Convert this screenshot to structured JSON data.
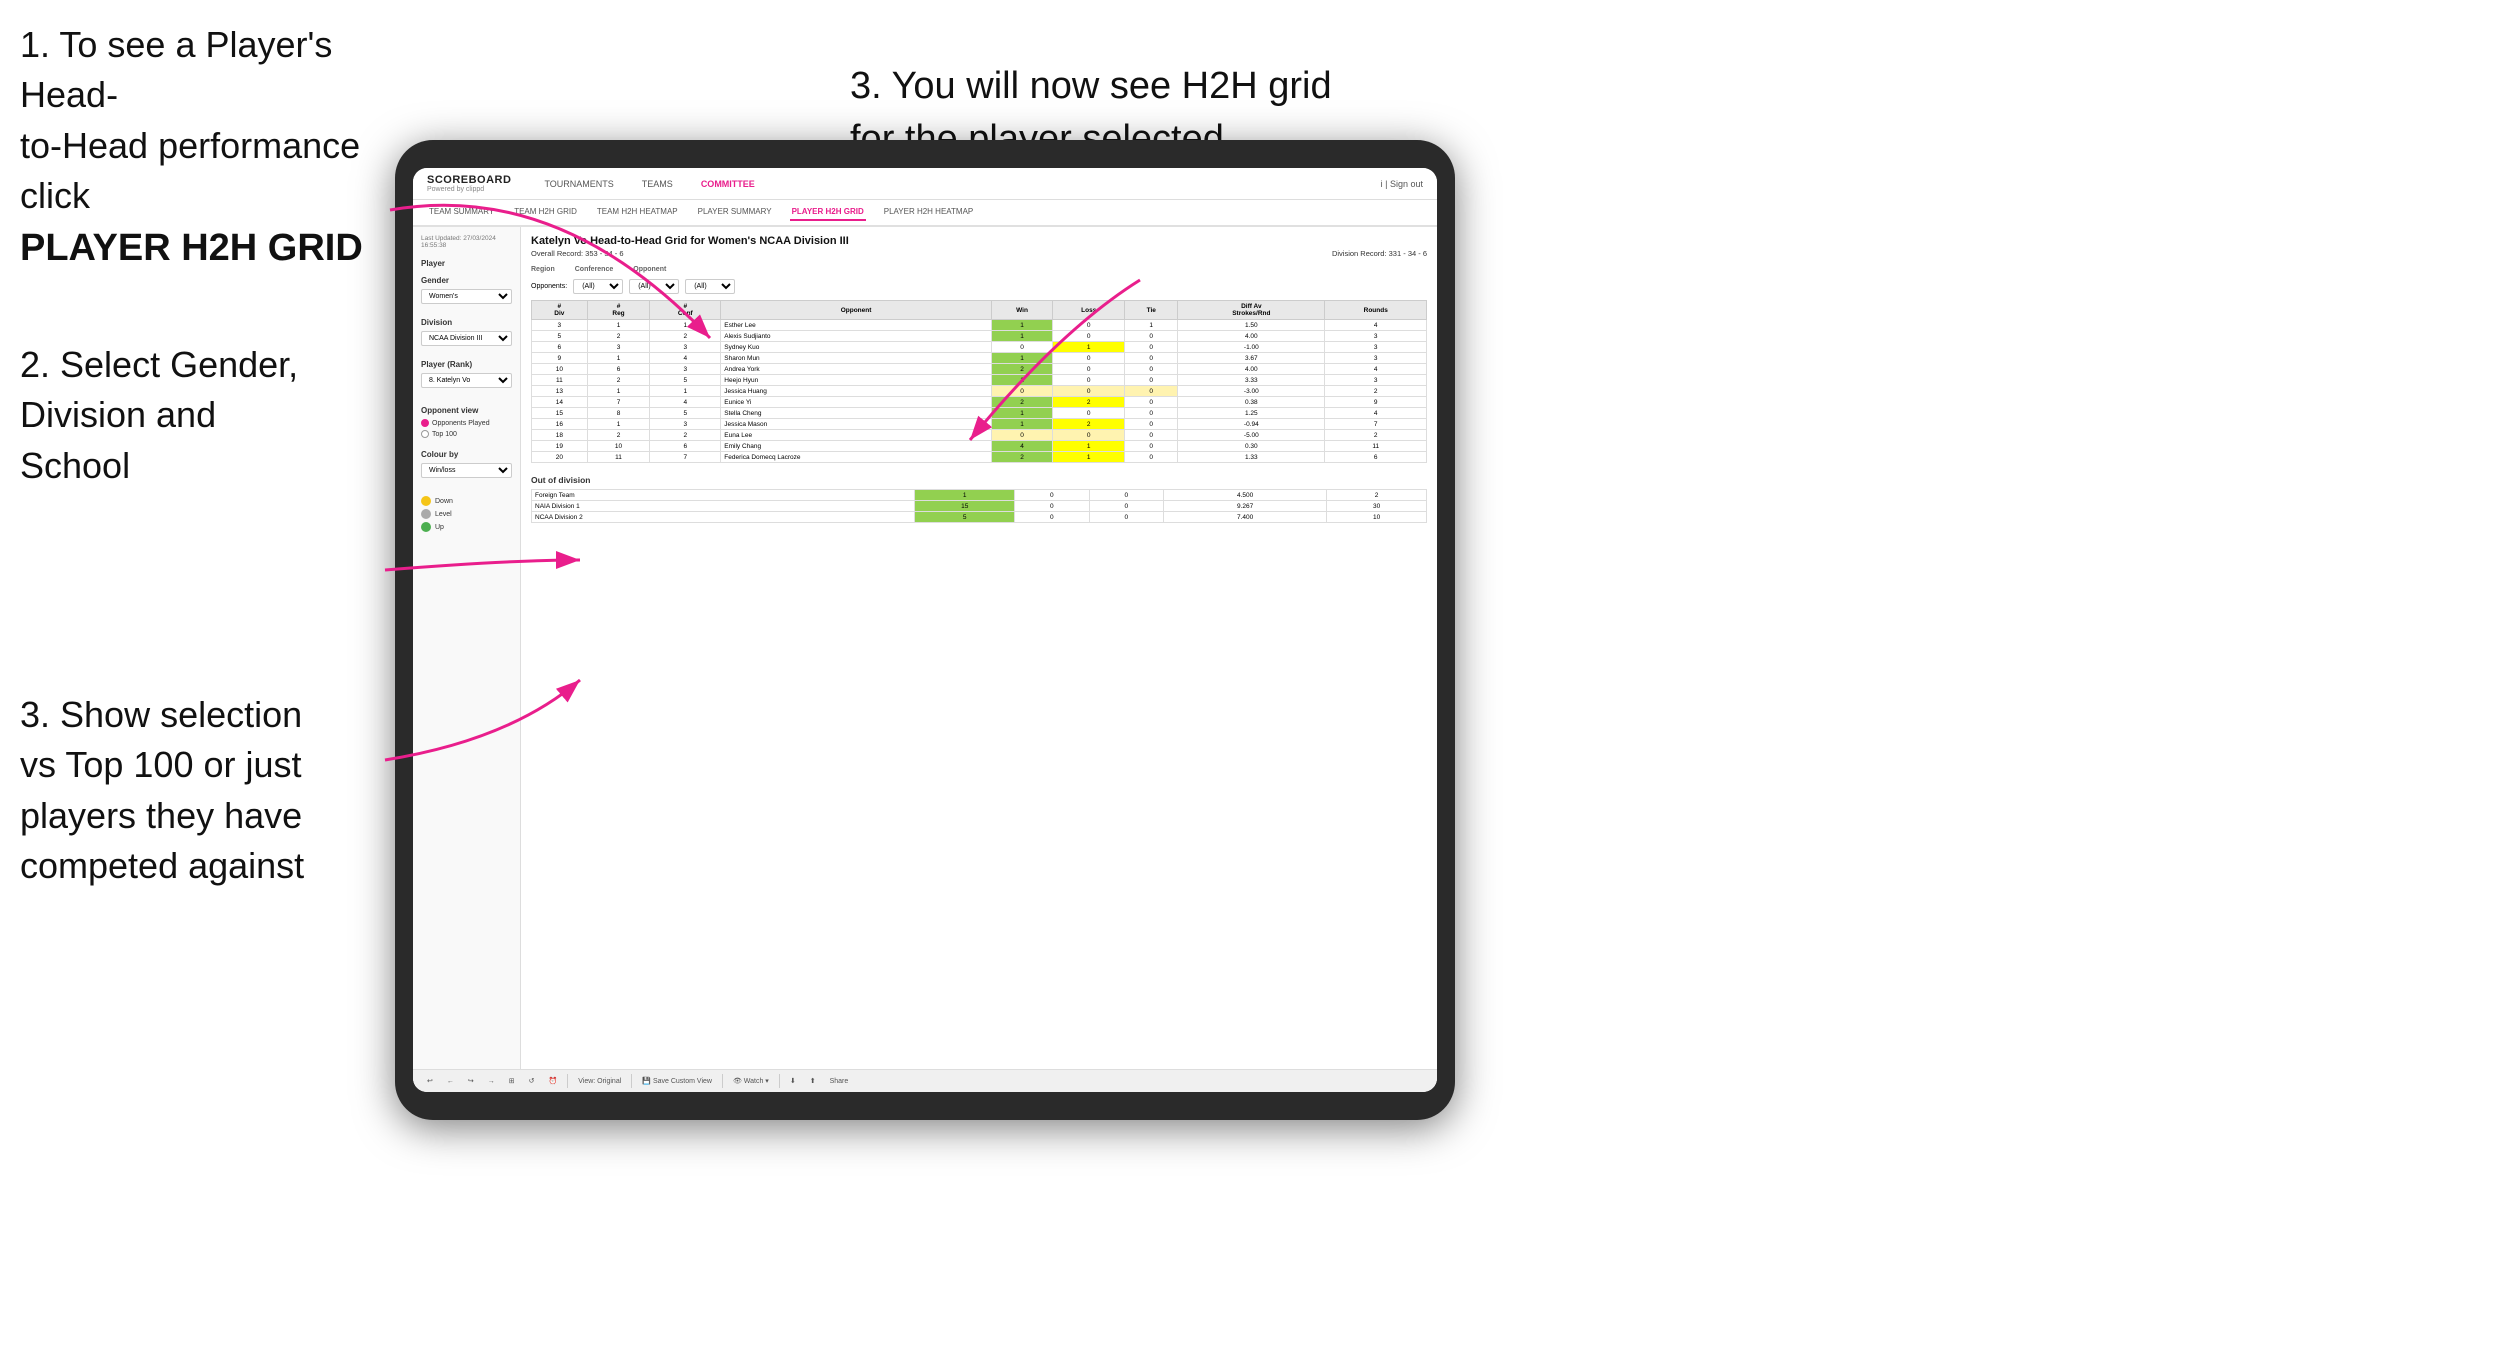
{
  "instructions": {
    "instr1_line1": "1. To see a Player's Head-",
    "instr1_line2": "to-Head performance click",
    "instr1_bold": "PLAYER H2H GRID",
    "instr2_line1": "2. Select Gender,",
    "instr2_line2": "Division and",
    "instr2_line3": "School",
    "instr3_top_line1": "3. You will now see H2H grid",
    "instr3_top_line2": "for the player selected",
    "instr3_bottom_line1": "3. Show selection",
    "instr3_bottom_line2": "vs Top 100 or just",
    "instr3_bottom_line3": "players they have",
    "instr3_bottom_line4": "competed against"
  },
  "nav": {
    "logo": "SCOREBOARD",
    "logo_sub": "Powered by clippd",
    "items": [
      "TOURNAMENTS",
      "TEAMS",
      "COMMITTEE"
    ],
    "active_item": "COMMITTEE",
    "sign_out": "Sign out"
  },
  "sub_nav": {
    "items": [
      "TEAM SUMMARY",
      "TEAM H2H GRID",
      "TEAM H2H HEATMAP",
      "PLAYER SUMMARY",
      "PLAYER H2H GRID",
      "PLAYER H2H HEATMAP"
    ],
    "active": "PLAYER H2H GRID"
  },
  "left_panel": {
    "timestamp": "Last Updated: 27/03/2024",
    "timestamp2": "16:55:38",
    "player_label": "Player",
    "gender_label": "Gender",
    "gender_value": "Women's",
    "division_label": "Division",
    "division_value": "NCAA Division III",
    "player_rank_label": "Player (Rank)",
    "player_rank_value": "8. Katelyn Vo",
    "opponent_view_label": "Opponent view",
    "radio1": "Opponents Played",
    "radio2": "Top 100",
    "colour_label": "Colour by",
    "colour_value": "Win/loss",
    "legend": [
      {
        "color": "#f5c518",
        "label": "Down"
      },
      {
        "color": "#aaaaaa",
        "label": "Level"
      },
      {
        "color": "#4caf50",
        "label": "Up"
      }
    ]
  },
  "main": {
    "title": "Katelyn Vo Head-to-Head Grid for Women's NCAA Division III",
    "overall_record": "Overall Record: 353 - 34 - 6",
    "division_record": "Division Record: 331 - 34 - 6",
    "region_label": "Region",
    "conference_label": "Conference",
    "opponent_label": "Opponent",
    "opponents_label": "Opponents:",
    "filter_all": "(All)",
    "table_headers": [
      "#\nDiv",
      "#\nReg",
      "#\nConf",
      "Opponent",
      "Win",
      "Loss",
      "Tie",
      "Diff Av\nStrokes/Rnd",
      "Rounds"
    ],
    "rows": [
      {
        "div": "3",
        "reg": "1",
        "conf": "1",
        "opponent": "Esther Lee",
        "win": "1",
        "loss": "0",
        "tie": "1",
        "diff": "1.50",
        "rounds": "4",
        "win_color": "",
        "loss_color": "",
        "tie_color": ""
      },
      {
        "div": "5",
        "reg": "2",
        "conf": "2",
        "opponent": "Alexis Sudjianto",
        "win": "1",
        "loss": "0",
        "tie": "0",
        "diff": "4.00",
        "rounds": "3",
        "win_color": "cell-green"
      },
      {
        "div": "6",
        "reg": "3",
        "conf": "3",
        "opponent": "Sydney Kuo",
        "win": "0",
        "loss": "1",
        "tie": "0",
        "diff": "-1.00",
        "rounds": "3"
      },
      {
        "div": "9",
        "reg": "1",
        "conf": "4",
        "opponent": "Sharon Mun",
        "win": "1",
        "loss": "0",
        "tie": "0",
        "diff": "3.67",
        "rounds": "3",
        "win_color": "cell-green"
      },
      {
        "div": "10",
        "reg": "6",
        "conf": "3",
        "opponent": "Andrea York",
        "win": "2",
        "loss": "0",
        "tie": "0",
        "diff": "4.00",
        "rounds": "4",
        "win_color": "cell-green"
      },
      {
        "div": "11",
        "reg": "2",
        "conf": "5",
        "opponent": "Heejo Hyun",
        "win": "1",
        "loss": "0",
        "tie": "0",
        "diff": "3.33",
        "rounds": "3",
        "win_color": "cell-green"
      },
      {
        "div": "13",
        "reg": "1",
        "conf": "1",
        "opponent": "Jessica Huang",
        "win": "0",
        "loss": "0",
        "tie": "0",
        "diff": "-3.00",
        "rounds": "2"
      },
      {
        "div": "14",
        "reg": "7",
        "conf": "4",
        "opponent": "Eunice Yi",
        "win": "2",
        "loss": "2",
        "tie": "0",
        "diff": "0.38",
        "rounds": "9"
      },
      {
        "div": "15",
        "reg": "8",
        "conf": "5",
        "opponent": "Stella Cheng",
        "win": "1",
        "loss": "0",
        "tie": "0",
        "diff": "1.25",
        "rounds": "4"
      },
      {
        "div": "16",
        "reg": "1",
        "conf": "3",
        "opponent": "Jessica Mason",
        "win": "1",
        "loss": "2",
        "tie": "0",
        "diff": "-0.94",
        "rounds": "7"
      },
      {
        "div": "18",
        "reg": "2",
        "conf": "2",
        "opponent": "Euna Lee",
        "win": "0",
        "loss": "0",
        "tie": "0",
        "diff": "-5.00",
        "rounds": "2"
      },
      {
        "div": "19",
        "reg": "10",
        "conf": "6",
        "opponent": "Emily Chang",
        "win": "4",
        "loss": "1",
        "tie": "0",
        "diff": "0.30",
        "rounds": "11"
      },
      {
        "div": "20",
        "reg": "11",
        "conf": "7",
        "opponent": "Federica Domecq Lacroze",
        "win": "2",
        "loss": "1",
        "tie": "0",
        "diff": "1.33",
        "rounds": "6"
      }
    ],
    "out_of_division_label": "Out of division",
    "out_of_division_rows": [
      {
        "label": "Foreign Team",
        "win": "1",
        "loss": "0",
        "tie": "0",
        "diff": "4.500",
        "rounds": "2"
      },
      {
        "label": "NAIA Division 1",
        "win": "15",
        "loss": "0",
        "tie": "0",
        "diff": "9.267",
        "rounds": "30"
      },
      {
        "label": "NCAA Division 2",
        "win": "5",
        "loss": "0",
        "tie": "0",
        "diff": "7.400",
        "rounds": "10"
      }
    ]
  },
  "toolbar": {
    "items": [
      "↩",
      "←",
      "↪",
      "→",
      "⊞",
      "↺",
      "⏰",
      "|",
      "View: Original",
      "|",
      "Save Custom View",
      "|",
      "👁 Watch ▾",
      "|",
      "⬇",
      "⬆",
      "Share"
    ]
  }
}
